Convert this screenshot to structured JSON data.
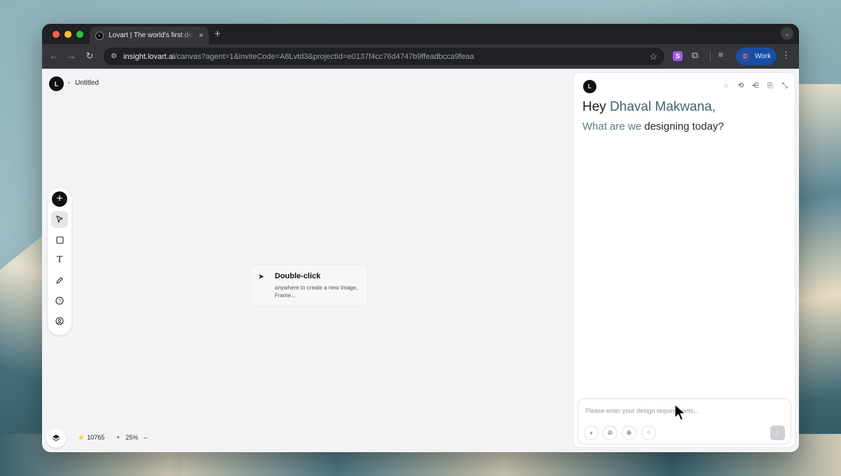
{
  "browser": {
    "tab_title": "Lovart | The world's first design agent",
    "tab_close": "×",
    "new_tab": "+",
    "url_host": "insight.lovart.ai",
    "url_path": "/canvas?agent=1&inviteCode=A8Lvtd3&projectId=e0137f4cc76d4747b9ffeadbcca9feaa",
    "extension_letter": "S",
    "profile_initial": "D",
    "profile_label": "Work"
  },
  "canvas": {
    "logo": "L",
    "document_title": "Untitled",
    "tools": [
      "add",
      "select",
      "rectangle",
      "text",
      "pen",
      "help",
      "account"
    ],
    "text_tool_glyph": "T",
    "hint": {
      "title": "Double-click",
      "body": "anywhere to create a new Image, Frame..."
    },
    "credits": "10765",
    "zoom_level": "25%"
  },
  "chat": {
    "greeting_prefix": "Hey ",
    "user_name": "Dhaval Makwana,",
    "question_part1": "What are we ",
    "question_part2": "designing today?",
    "input_placeholder": "Please enter your design requirements...",
    "header_actions": [
      "chat-icon",
      "history-icon",
      "share-icon",
      "copy-icon",
      "collapse-icon"
    ]
  },
  "colors": {
    "accent_name": "#3e6570",
    "profile_chip": "#174ea6",
    "extension": "#a259e6"
  }
}
